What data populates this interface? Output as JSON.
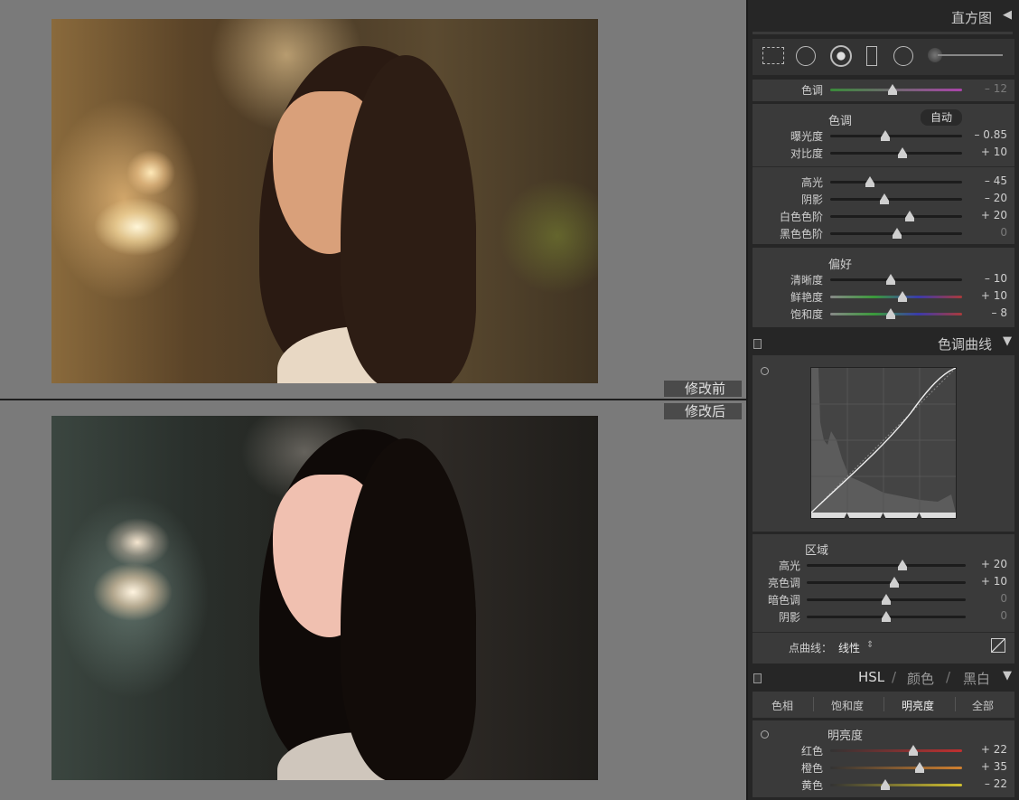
{
  "compare": {
    "before_label": "修改前",
    "after_label": "修改后"
  },
  "histogram": {
    "title": "直方图",
    "collapse_icon": "triangle-left-icon"
  },
  "tools": {
    "icons": [
      "crop-overlay-icon",
      "spot-removal-icon",
      "red-eye-icon",
      "graduated-filter-icon",
      "radial-filter-icon",
      "adjustment-brush-icon"
    ]
  },
  "tint": {
    "label": "色调",
    "value": "– 12",
    "pos": 0.47
  },
  "tone": {
    "title": "色调",
    "auto_label": "自动",
    "exposure": {
      "label": "曝光度",
      "value": "– 0.85",
      "pos": 0.42
    },
    "contrast": {
      "label": "对比度",
      "value": "+ 10",
      "pos": 0.55
    },
    "highlights": {
      "label": "高光",
      "value": "– 45",
      "pos": 0.3
    },
    "shadows": {
      "label": "阴影",
      "value": "– 20",
      "pos": 0.41
    },
    "whites": {
      "label": "白色色阶",
      "value": "+ 20",
      "pos": 0.6
    },
    "blacks": {
      "label": "黑色色阶",
      "value": "0",
      "pos": 0.51
    }
  },
  "presence": {
    "title": "偏好",
    "clarity": {
      "label": "清晰度",
      "value": "– 10",
      "pos": 0.46
    },
    "vibrance": {
      "label": "鲜艳度",
      "value": "+ 10",
      "pos": 0.55
    },
    "saturation": {
      "label": "饱和度",
      "value": "– 8",
      "pos": 0.46
    }
  },
  "tone_curve": {
    "title": "色调曲线",
    "collapse_icon": "triangle-down-icon",
    "region_title": "区域",
    "highlights": {
      "label": "高光",
      "value": "+ 20",
      "pos": 0.6
    },
    "lights": {
      "label": "亮色调",
      "value": "+ 10",
      "pos": 0.55
    },
    "darks": {
      "label": "暗色调",
      "value": "0",
      "pos": 0.5
    },
    "shadows": {
      "label": "阴影",
      "value": "0",
      "pos": 0.5
    },
    "point_curve_label": "点曲线：",
    "point_curve_value": "线性",
    "point_curve_arrows": "⇕"
  },
  "hsl": {
    "tab_hsl": "HSL",
    "sep": "/",
    "tab_color": "颜色",
    "tab_bw": "黑白",
    "sub_hue": "色相",
    "sub_saturation": "饱和度",
    "sub_luminance": "明亮度",
    "sub_all": "全部",
    "section_title": "明亮度",
    "red": {
      "label": "红色",
      "value": "+ 22",
      "pos": 0.63
    },
    "orange": {
      "label": "橙色",
      "value": "+ 35",
      "pos": 0.68
    },
    "yellow": {
      "label": "黄色",
      "value": "– 22",
      "pos": 0.42
    }
  }
}
